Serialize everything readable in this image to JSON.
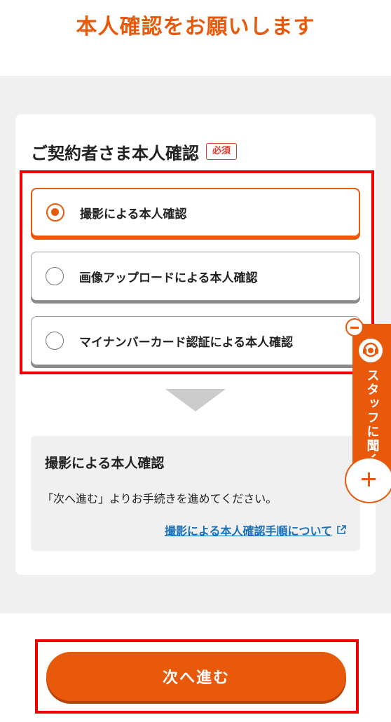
{
  "header": {
    "title": "本人確認をお願いします"
  },
  "section": {
    "title": "ご契約者さま本人確認",
    "required_badge": "必須"
  },
  "options": [
    {
      "label": "撮影による本人確認",
      "selected": true
    },
    {
      "label": "画像アップロードによる本人確認",
      "selected": false
    },
    {
      "label": "マイナンバーカード認証による本人確認",
      "selected": false
    }
  ],
  "info": {
    "title": "撮影による本人確認",
    "text": "「次へ進む」よりお手続きを進めてください。",
    "link": "撮影による本人確認手順について"
  },
  "staff_tab": {
    "label": "スタッフに聞く"
  },
  "next_button": {
    "label": "次へ進む"
  },
  "colors": {
    "accent": "#e8590c",
    "link": "#1a6fb5",
    "annotation": "#f00000",
    "required": "#d93b2b"
  },
  "icons": [
    "external-link-icon",
    "headset-icon",
    "minus-icon",
    "plus-icon",
    "down-arrow-icon"
  ]
}
